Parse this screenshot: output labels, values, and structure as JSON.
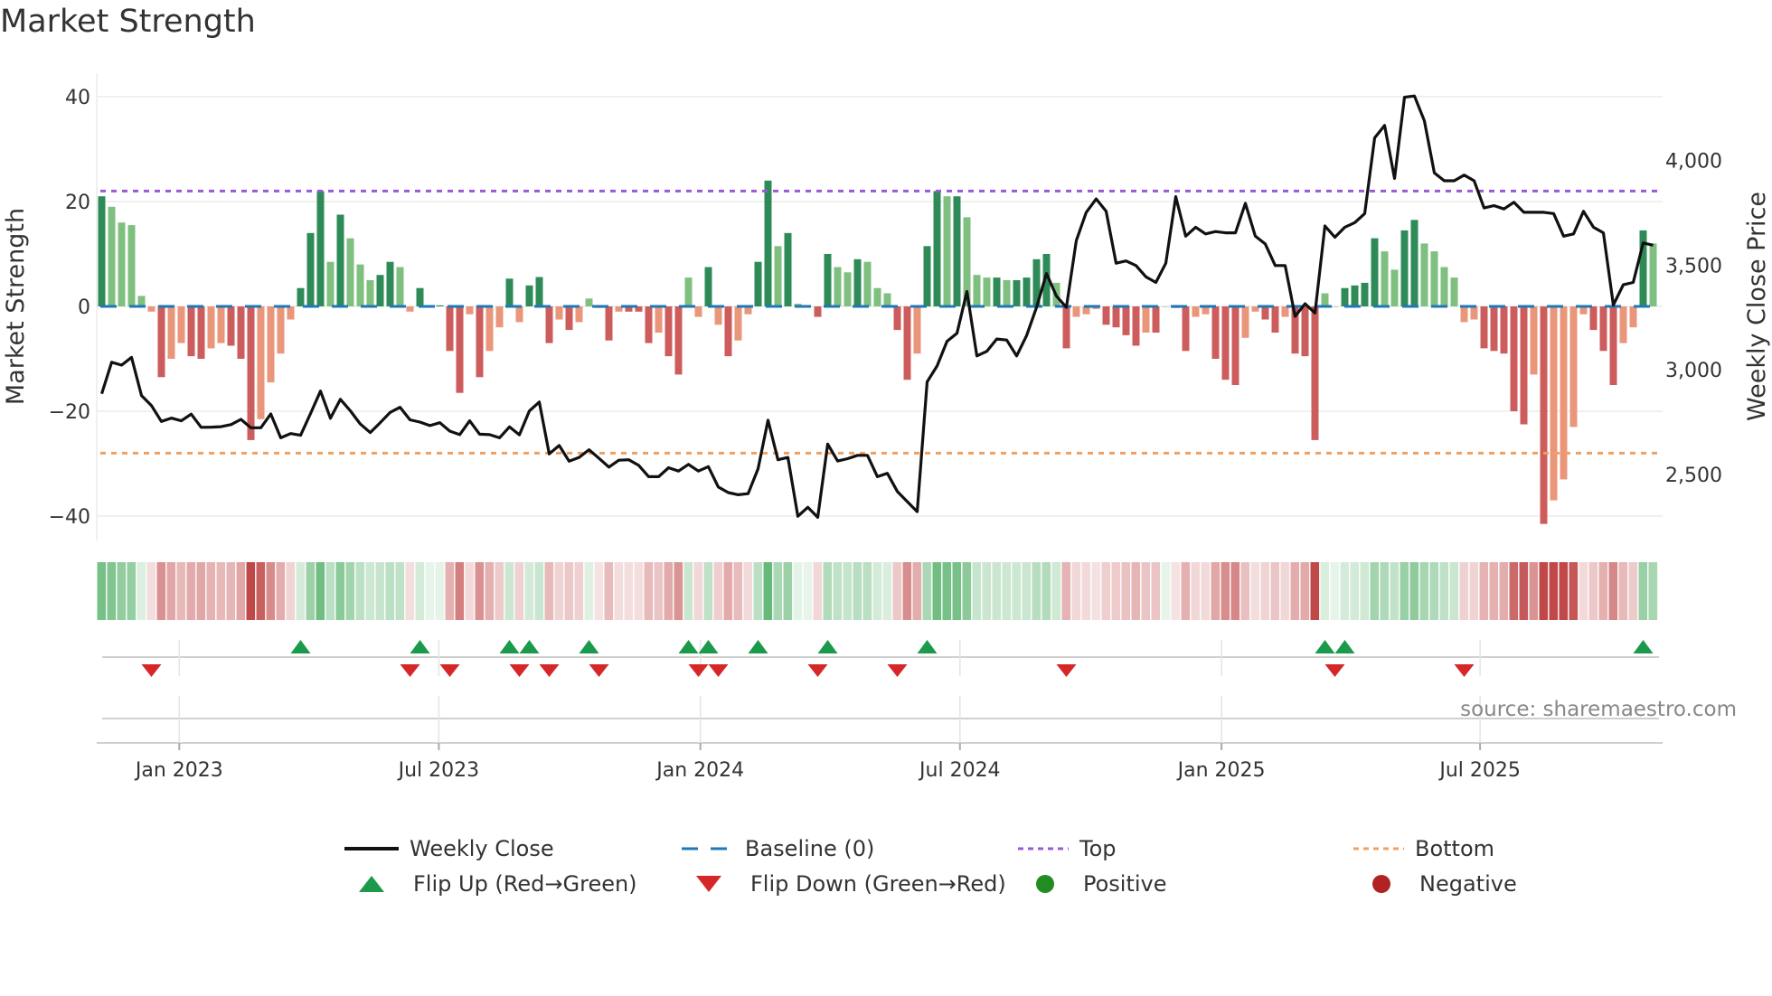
{
  "title": "Market Strength",
  "source": "source: sharemaestro.com",
  "colors": {
    "pos_strong": "#2e8b57",
    "pos_weak": "#7fbf7f",
    "neg_strong": "#cd5c5c",
    "neg_weak": "#e9967a",
    "price": "#111111",
    "baseline": "#1f77b4",
    "top": "#9b59d6",
    "bottom": "#f0a060",
    "flip_up": "#1a9a4a",
    "flip_down": "#d62728",
    "positive": "#228b22",
    "negative": "#b22222"
  },
  "legend": {
    "weekly_close": "Weekly Close",
    "baseline": "Baseline (0)",
    "top": "Top",
    "bottom": "Bottom",
    "flip_up": "Flip Up (Red→Green)",
    "flip_down": "Flip Down (Green→Red)",
    "positive": "Positive",
    "negative": "Negative"
  },
  "chart_data": {
    "type": "bar",
    "title": "Market Strength",
    "ylabel": "Market Strength",
    "y2label": "Weekly Close Price",
    "ylim": [
      -45,
      45
    ],
    "y2lim": [
      2200,
      4350
    ],
    "yticks": [
      {
        "v": 40,
        "label": "40"
      },
      {
        "v": 20,
        "label": "20"
      },
      {
        "v": 0,
        "label": "0"
      },
      {
        "v": -20,
        "label": "−20"
      },
      {
        "v": -40,
        "label": "−40"
      }
    ],
    "y2ticks": [
      {
        "v": 4000,
        "label": "4,000"
      },
      {
        "v": 3500,
        "label": "3,500"
      },
      {
        "v": 3000,
        "label": "3,000"
      },
      {
        "v": 2500,
        "label": "2,500"
      }
    ],
    "xticks": [
      {
        "week": 7.8,
        "label": "Jan 2023"
      },
      {
        "week": 33.9,
        "label": "Jul 2023"
      },
      {
        "week": 60.2,
        "label": "Jan 2024"
      },
      {
        "week": 86.3,
        "label": "Jul 2024"
      },
      {
        "week": 112.6,
        "label": "Jan 2025"
      },
      {
        "week": 138.6,
        "label": "Jul 2025"
      }
    ],
    "top_level": 22,
    "bottom_level": -28,
    "baseline": 0,
    "strength": [
      21,
      19,
      16,
      15.5,
      2,
      -1,
      -13.5,
      -10,
      -7,
      -9.5,
      -10,
      -8,
      -7,
      -7.5,
      -10,
      -25.5,
      -21.5,
      -14.5,
      -9,
      -2.5,
      3.5,
      14,
      22,
      8.5,
      17.5,
      13,
      8,
      5,
      6,
      8.5,
      7.5,
      -1,
      3.5,
      0,
      0.2,
      -8.5,
      -16.5,
      -1.5,
      -13.5,
      -8.5,
      -4,
      5.3,
      -3,
      4,
      5.6,
      -7,
      -2.5,
      -4.5,
      -3,
      1.5,
      -0.3,
      -6.5,
      -1,
      -1,
      -1,
      -7,
      -5,
      -9.5,
      -13,
      5.5,
      -2,
      7.5,
      -3.5,
      -9.5,
      -6.5,
      -1.5,
      8.5,
      24,
      11.5,
      14,
      0.5,
      0,
      -2,
      10,
      7.5,
      6.5,
      9,
      8.5,
      3.5,
      2.5,
      -4.5,
      -14,
      -9,
      11.5,
      22,
      21,
      21,
      17,
      6,
      5.5,
      5.5,
      5,
      5,
      5.5,
      9,
      10,
      4.5,
      -8,
      -2,
      -1.5,
      -0.5,
      -3.5,
      -4,
      -5.5,
      -7.5,
      -5,
      -5,
      0,
      -0.3,
      -8.5,
      -2,
      -1.5,
      -10,
      -14,
      -15,
      -6,
      -1,
      -2.5,
      -5,
      -2,
      -9,
      -9.5,
      -25.5,
      2.5,
      0,
      3.5,
      4,
      4.5,
      13,
      10.5,
      7,
      14.5,
      16.5,
      12,
      10.5,
      7.5,
      5.5,
      -3,
      -2.5,
      -8,
      -8.5,
      -9,
      -20,
      -22.5,
      -13,
      -41.5,
      -37,
      -33,
      -23,
      -1.5,
      -4.5,
      -8.5,
      -15,
      -7,
      -4,
      14.5,
      12
    ],
    "weekly_close": [
      2885,
      3036,
      3022,
      3059,
      2877,
      2829,
      2753,
      2769,
      2756,
      2788,
      2725,
      2726,
      2728,
      2738,
      2763,
      2723,
      2723,
      2789,
      2675,
      2695,
      2687,
      2791,
      2898,
      2768,
      2859,
      2804,
      2741,
      2700,
      2747,
      2796,
      2821,
      2761,
      2750,
      2733,
      2747,
      2707,
      2690,
      2756,
      2692,
      2690,
      2675,
      2727,
      2689,
      2803,
      2846,
      2598,
      2638,
      2563,
      2581,
      2618,
      2577,
      2535,
      2568,
      2570,
      2543,
      2489,
      2489,
      2532,
      2516,
      2548,
      2516,
      2537,
      2440,
      2413,
      2403,
      2408,
      2527,
      2759,
      2570,
      2581,
      2300,
      2343,
      2295,
      2645,
      2564,
      2575,
      2591,
      2591,
      2489,
      2505,
      2419,
      2370,
      2322,
      2942,
      3018,
      3136,
      3174,
      3374,
      3066,
      3088,
      3147,
      3142,
      3066,
      3163,
      3298,
      3460,
      3352,
      3298,
      3617,
      3752,
      3816,
      3757,
      3509,
      3520,
      3498,
      3444,
      3417,
      3509,
      3827,
      3638,
      3681,
      3649,
      3660,
      3654,
      3654,
      3795,
      3638,
      3601,
      3498,
      3498,
      3255,
      3315,
      3271,
      3687,
      3633,
      3681,
      3703,
      3746,
      4108,
      4167,
      3914,
      4302,
      4308,
      4189,
      3941,
      3903,
      3903,
      3930,
      3903,
      3773,
      3784,
      3768,
      3800,
      3752,
      3752,
      3752,
      3746,
      3638,
      3649,
      3757,
      3681,
      3654,
      3309,
      3406,
      3417,
      3606,
      3595
    ],
    "flip_up_weeks": [
      20,
      32,
      41,
      43,
      49,
      59,
      61,
      66,
      73,
      83,
      123,
      125,
      155
    ],
    "flip_down_weeks": [
      5,
      31,
      35,
      42,
      45,
      50,
      60,
      62,
      72,
      80,
      97,
      124,
      137
    ]
  }
}
